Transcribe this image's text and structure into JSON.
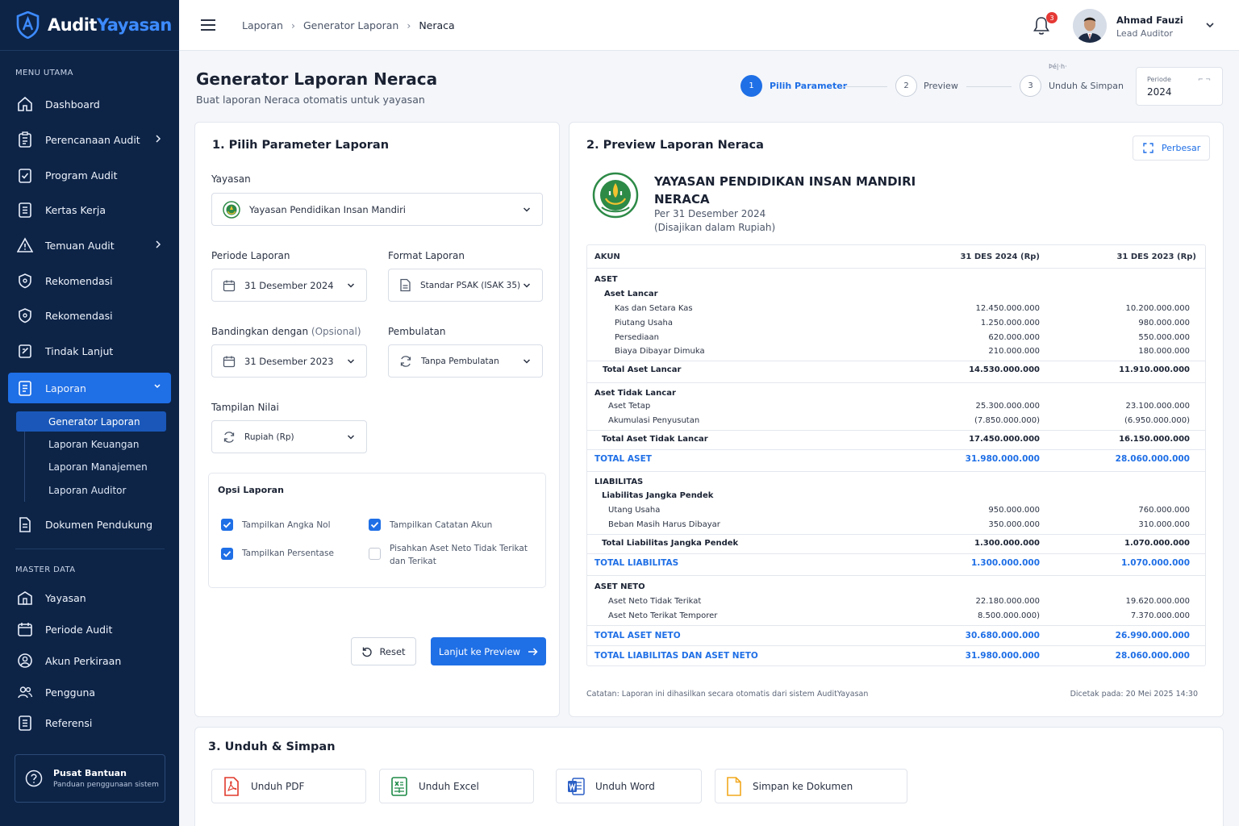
{
  "app": {
    "brand_a": "Audit",
    "brand_b": "Yayasan"
  },
  "colors": {
    "sidebar_bg": "#0d2447",
    "accent": "#1f6fe6",
    "danger": "#e53935"
  },
  "sidebar": {
    "menu_label": "MENU UTAMA",
    "items": [
      {
        "label": "Dashboard",
        "icon": "home-icon"
      },
      {
        "label": "Perencanaan Audit",
        "icon": "clipboard-icon",
        "chevron": true
      },
      {
        "label": "Program Audit",
        "icon": "checklist-icon"
      },
      {
        "label": "Kertas Kerja",
        "icon": "document-icon"
      },
      {
        "label": "Temuan Audit",
        "icon": "warning-icon",
        "chevron": true
      },
      {
        "label": "Rekomendasi",
        "icon": "shield-icon"
      },
      {
        "label": "Rekomendasi",
        "icon": "shield-icon"
      },
      {
        "label": "Tindak Lanjut",
        "icon": "edit-icon"
      },
      {
        "label": "Laporan",
        "icon": "report-icon",
        "active": true
      },
      {
        "label": "Dokumen Pendukung",
        "icon": "file-icon"
      }
    ],
    "sub_items": [
      "Generator Laporan",
      "Laporan Keuangan",
      "Laporan Manajemen",
      "Laporan Auditor"
    ],
    "master_label": "MASTER DATA",
    "master_items": [
      {
        "label": "Yayasan",
        "icon": "building-icon"
      },
      {
        "label": "Periode Audit",
        "icon": "calendar-icon"
      },
      {
        "label": "Akun Perkiraan",
        "icon": "user-circle-icon"
      },
      {
        "label": "Pengguna",
        "icon": "users-icon"
      },
      {
        "label": "Referensi",
        "icon": "list-icon"
      }
    ],
    "help_title": "Pusat Bantuan",
    "help_sub": "Panduan penggunaan sistem"
  },
  "topbar": {
    "breadcrumbs": [
      "Laporan",
      "Generator Laporan",
      "Neraca"
    ],
    "notif_count": "3",
    "user_name": "Ahmad Fauzi",
    "user_role": "Lead Auditor"
  },
  "header": {
    "title": "Generator Laporan Neraca",
    "subtitle": "Buat laporan Neraca otomatis untuk yayasan",
    "steps": [
      {
        "num": "1",
        "label": "Pilih Parameter"
      },
      {
        "num": "2",
        "label": "Preview"
      },
      {
        "num": "3",
        "label": "Unduh & Simpan"
      }
    ],
    "tiny_label": "Þé|·h·",
    "period_label": "Periode",
    "period_value": "2024",
    "period_mark": "⌐ ¬"
  },
  "params": {
    "title": "1. Pilih Parameter Laporan",
    "yayasan_label": "Yayasan",
    "yayasan_value": "Yayasan Pendidikan Insan Mandiri",
    "periode_label": "Periode Laporan",
    "periode_value": "31 Desember 2024",
    "format_label": "Format Laporan",
    "format_value": "Standar PSAK (ISAK 35)",
    "banding_label": "Bandingkan dengan",
    "banding_opt": "(Opsional)",
    "banding_value": "31 Desember 2023",
    "pembulatan_label": "Pembulatan",
    "pembulatan_value": "Tanpa Pembulatan",
    "tampilan_label": "Tampilan Nilai",
    "tampilan_value": "Rupiah (Rp)",
    "opsi_title": "Opsi Laporan",
    "opsi": [
      {
        "label": "Tampilkan Angka Nol",
        "checked": true
      },
      {
        "label": "Tampilkan Catatan Akun",
        "checked": true
      },
      {
        "label": "Tampilkan Persentase",
        "checked": true
      },
      {
        "label_1": "Pisahkan Aset Neto Tidak Terikat",
        "label_2": "dan Terikat",
        "checked": false
      }
    ],
    "reset_label": "Reset",
    "next_label": "Lanjut ke Preview"
  },
  "preview": {
    "title": "2. Preview Laporan Neraca",
    "expand_label": "Perbesar",
    "org_name": "YAYASAN PENDIDIKAN INSAN MANDIRI",
    "report_name": "NERACA",
    "as_of": "Per 31 Desember 2024",
    "currency_note": "(Disajikan dalam Rupiah)",
    "col_akun": "AKUN",
    "col_2024": "31 DES 2024 (Rp)",
    "col_2023": "31 DES 2023 (Rp)",
    "rows": [
      {
        "name": "ASET",
        "v1": "",
        "v2": ""
      },
      {
        "name": "Aset Lancar",
        "v1": "",
        "v2": ""
      },
      {
        "name": "Kas dan Setara Kas",
        "v1": "12.450.000.000",
        "v2": "10.200.000.000"
      },
      {
        "name": "Piutang Usaha",
        "v1": "1.250.000.000",
        "v2": "980.000.000"
      },
      {
        "name": "Persediaan",
        "v1": "620.000.000",
        "v2": "550.000.000"
      },
      {
        "name": "Biaya Dibayar Dimuka",
        "v1": "210.000.000",
        "v2": "180.000.000"
      },
      {
        "name": "Total Aset Lancar",
        "v1": "14.530.000.000",
        "v2": "11.910.000.000"
      },
      {
        "name": "Aset Tidak Lancar",
        "v1": "",
        "v2": ""
      },
      {
        "name": "Aset Tetap",
        "v1": "25.300.000.000",
        "v2": "23.100.000.000"
      },
      {
        "name": "Akumulasi Penyusutan",
        "v1": "(7.850.000.000)",
        "v2": "(6.950.000.000)"
      },
      {
        "name": "Total Aset Tidak Lancar",
        "v1": "17.450.000.000",
        "v2": "16.150.000.000"
      },
      {
        "name": "TOTAL ASET",
        "v1": "31.980.000.000",
        "v2": "28.060.000.000"
      },
      {
        "name": "LIABILITAS",
        "v1": "",
        "v2": ""
      },
      {
        "name": "Liabilitas Jangka Pendek",
        "v1": "",
        "v2": ""
      },
      {
        "name": "Utang Usaha",
        "v1": "950.000.000",
        "v2": "760.000.000"
      },
      {
        "name": "Beban Masih Harus Dibayar",
        "v1": "350.000.000",
        "v2": "310.000.000"
      },
      {
        "name": "Total Liabilitas Jangka Pendek",
        "v1": "1.300.000.000",
        "v2": "1.070.000.000"
      },
      {
        "name": "TOTAL LIABILITAS",
        "v1": "1.300.000.000",
        "v2": "1.070.000.000"
      },
      {
        "name": "ASET NETO",
        "v1": "",
        "v2": ""
      },
      {
        "name": "Aset Neto Tidak Terikat",
        "v1": "22.180.000.000",
        "v2": "19.620.000.000"
      },
      {
        "name": "Aset Neto Terikat Temporer",
        "v1": "8.500.000.000)",
        "v2": "7.370.000.000"
      },
      {
        "name": "TOTAL ASET NETO",
        "v1": "30.680.000.000",
        "v2": "26.990.000.000"
      },
      {
        "name": "TOTAL LIABILITAS DAN ASET NETO",
        "v1": "31.980.000.000",
        "v2": "28.060.000.000"
      }
    ],
    "footer_note": "Catatan: Laporan ini dihasilkan secara otomatis dari sistem AuditYayasan",
    "printed_at": "Dicetak pada: 20 Mei 2025 14:30"
  },
  "download": {
    "title": "3. Unduh & Simpan",
    "pdf": "Unduh PDF",
    "excel": "Unduh Excel",
    "word": "Unduh Word",
    "save": "Simpan ke Dokumen"
  }
}
